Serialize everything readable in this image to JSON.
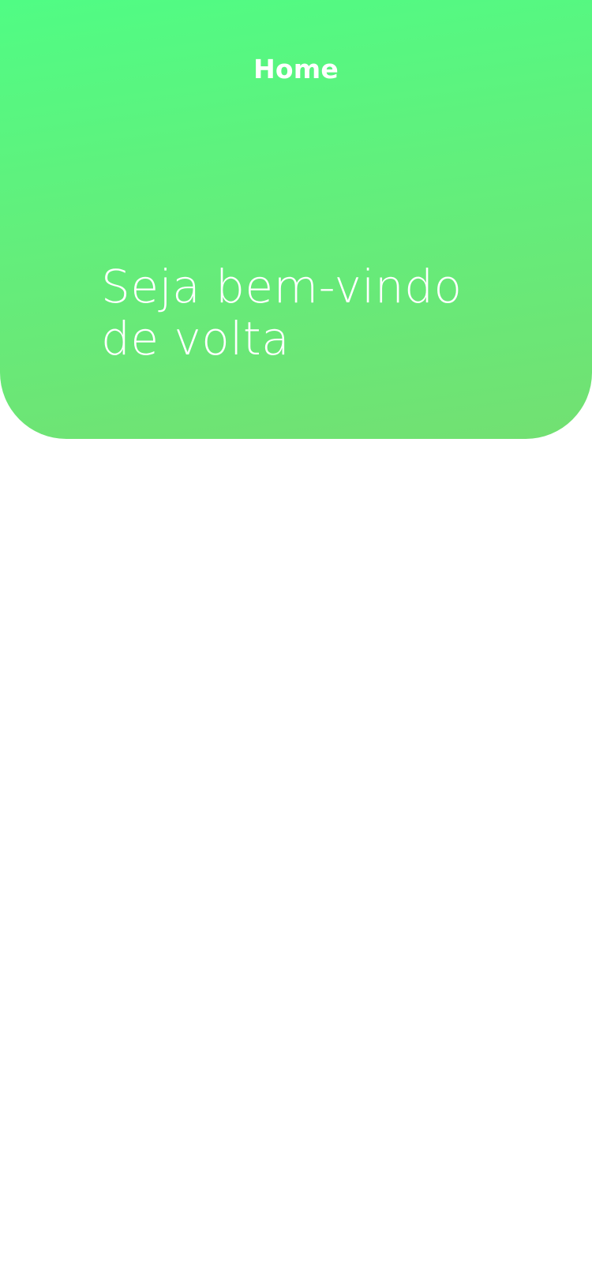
{
  "nav": {
    "title": "Home"
  },
  "hero": {
    "line1": "Seja bem-vindo",
    "line2": "de volta"
  },
  "colors": {
    "gradient_top": "#50fc84",
    "gradient_bottom": "#72e072",
    "text": "#ffffff",
    "background": "#ffffff"
  }
}
